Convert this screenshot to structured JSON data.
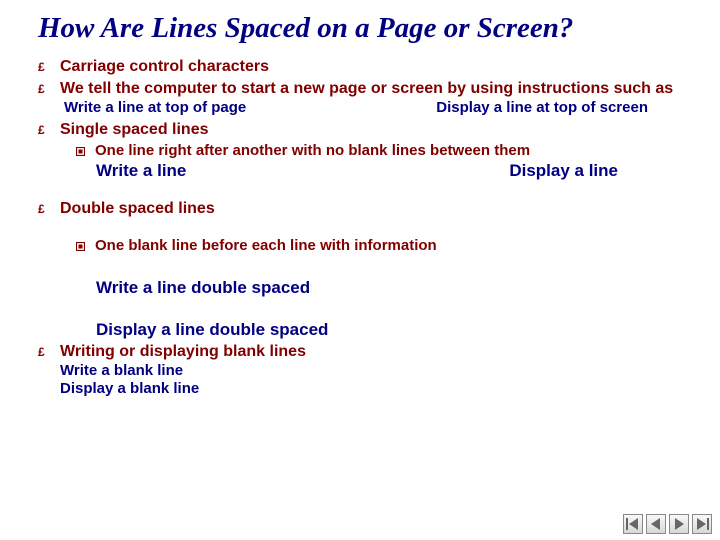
{
  "title": "How Are Lines Spaced on a Page or Screen?",
  "bullets": {
    "b1": "Carriage control characters",
    "b2": "We tell the computer to start a new page or screen by using instructions such as",
    "b2_sub_left": "Write a line at top of page",
    "b2_sub_right": "Display a line at top of screen",
    "b3": "Single spaced lines",
    "b3_sq": "One line right after another with no blank lines between them",
    "b3_ex_left": "Write a line",
    "b3_ex_right": "Display a line",
    "b4": "Double spaced lines",
    "b4_sq": "One blank line before each line with information",
    "b4_ex1": "Write a line double spaced",
    "b4_ex2": "Display a line double spaced",
    "b5": "Writing or displaying blank lines",
    "b5_sub1": "Write a blank line",
    "b5_sub2": "Display a blank line"
  },
  "nav": {
    "first": "first-slide",
    "prev": "previous-slide",
    "next": "next-slide",
    "last": "last-slide"
  }
}
